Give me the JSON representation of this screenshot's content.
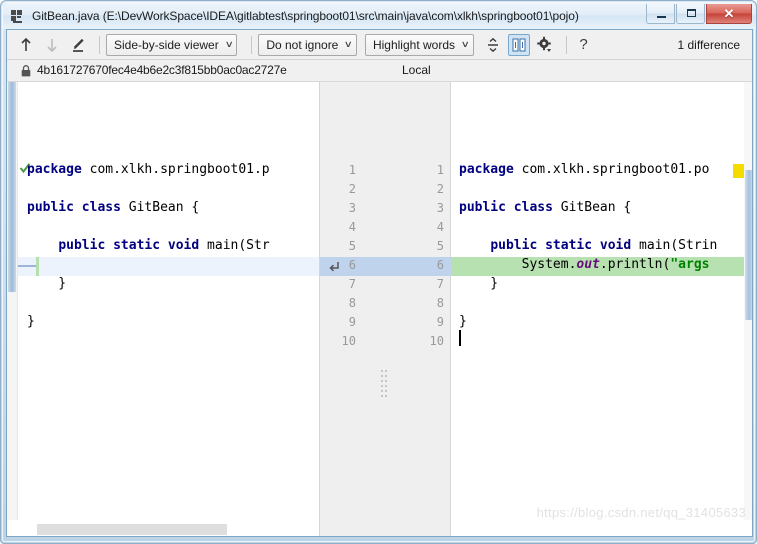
{
  "window": {
    "title": "GitBean.java (E:\\DevWorkSpace\\IDEA\\gitlabtest\\springboot01\\src\\main\\java\\com\\xlkh\\springboot01\\pojo)",
    "icon": "java-file-icon",
    "buttons": {
      "minimize": "minimize-button",
      "maximize": "maximize-button",
      "close_label": "✕"
    }
  },
  "toolbar": {
    "prev_diff_icon": "arrow-up-icon",
    "next_diff_icon": "arrow-down-icon",
    "edit_icon": "pencil-edit-icon",
    "viewer_mode": "Side-by-side viewer",
    "ignore_policy": "Do not ignore",
    "highlight_policy": "Highlight words",
    "collapse_icon": "collapse-unchanged-icon",
    "split_icon": "synchronize-scroll-icon",
    "settings_icon": "gear-settings-icon",
    "help_icon": "?",
    "difference_count": "1 difference",
    "caret": "∨"
  },
  "header": {
    "lock_icon": "lock-icon",
    "revision": "4b161727670fec4e4b6e2c3f815bb0ac0ac2727e",
    "local_label": "Local"
  },
  "gutter": {
    "left_line_numbers": [
      "1",
      "2",
      "3",
      "4",
      "5",
      "6",
      "7",
      "8",
      "9",
      "10"
    ],
    "right_line_numbers": [
      "1",
      "2",
      "3",
      "4",
      "5",
      "6",
      "7",
      "8",
      "9",
      "10"
    ],
    "highlighted_line": "6",
    "change_arrow_icon": "apply-change-arrow-icon",
    "drag_handle_icon": "drag-handle-dots-icon"
  },
  "left_pane": {
    "status_icon": "green-check-icon",
    "lines": [
      {
        "n": 1,
        "tokens": [
          {
            "t": "package",
            "c": "kw"
          },
          {
            "t": " com.xlkh.springboot01.p",
            "c": "id"
          }
        ]
      },
      {
        "n": 2,
        "tokens": []
      },
      {
        "n": 3,
        "tokens": [
          {
            "t": "public",
            "c": "kw"
          },
          {
            "t": " ",
            "c": "id"
          },
          {
            "t": "class",
            "c": "kw"
          },
          {
            "t": " GitBean {",
            "c": "id"
          }
        ]
      },
      {
        "n": 4,
        "tokens": []
      },
      {
        "n": 5,
        "tokens": [
          {
            "t": "    ",
            "c": "id"
          },
          {
            "t": "public",
            "c": "kw"
          },
          {
            "t": " ",
            "c": "id"
          },
          {
            "t": "static",
            "c": "kw"
          },
          {
            "t": " ",
            "c": "id"
          },
          {
            "t": "void",
            "c": "kw"
          },
          {
            "t": " main(Str",
            "c": "id"
          }
        ]
      },
      {
        "n": 6,
        "tokens": []
      },
      {
        "n": 7,
        "tokens": [
          {
            "t": "    }",
            "c": "id"
          }
        ]
      },
      {
        "n": 8,
        "tokens": []
      },
      {
        "n": 9,
        "tokens": [
          {
            "t": "}",
            "c": "id"
          }
        ]
      },
      {
        "n": 10,
        "tokens": []
      }
    ]
  },
  "right_pane": {
    "lines": [
      {
        "n": 1,
        "tokens": [
          {
            "t": "package",
            "c": "kw"
          },
          {
            "t": " com.xlkh.springboot01.po",
            "c": "id"
          }
        ]
      },
      {
        "n": 2,
        "tokens": []
      },
      {
        "n": 3,
        "tokens": [
          {
            "t": "public",
            "c": "kw"
          },
          {
            "t": " ",
            "c": "id"
          },
          {
            "t": "class",
            "c": "kw"
          },
          {
            "t": " GitBean {",
            "c": "id"
          }
        ]
      },
      {
        "n": 4,
        "tokens": []
      },
      {
        "n": 5,
        "tokens": [
          {
            "t": "    ",
            "c": "id"
          },
          {
            "t": "public",
            "c": "kw"
          },
          {
            "t": " ",
            "c": "id"
          },
          {
            "t": "static",
            "c": "kw"
          },
          {
            "t": " ",
            "c": "id"
          },
          {
            "t": "void",
            "c": "kw"
          },
          {
            "t": " main(Strin",
            "c": "id"
          }
        ]
      },
      {
        "n": 6,
        "tokens": [
          {
            "t": "        System.",
            "c": "id"
          },
          {
            "t": "out",
            "c": "fld"
          },
          {
            "t": ".println(",
            "c": "id"
          },
          {
            "t": "\"args",
            "c": "str"
          }
        ]
      },
      {
        "n": 7,
        "tokens": [
          {
            "t": "    }",
            "c": "id"
          }
        ]
      },
      {
        "n": 8,
        "tokens": []
      },
      {
        "n": 9,
        "tokens": [
          {
            "t": "}",
            "c": "id"
          }
        ]
      },
      {
        "n": 10,
        "tokens": []
      }
    ],
    "added_line_number": 6
  },
  "watermark": "https://blog.csdn.net/qq_31405633",
  "colors": {
    "added_bg": "#b7e1b0",
    "current_line_bg": "#edf3fd",
    "gutter_highlight": "#bfd3ec",
    "keyword": "#000080",
    "string": "#008000",
    "field": "#660e7a",
    "accent_selected": "#cfe3f5",
    "marker_yellow": "#f5dc00"
  }
}
